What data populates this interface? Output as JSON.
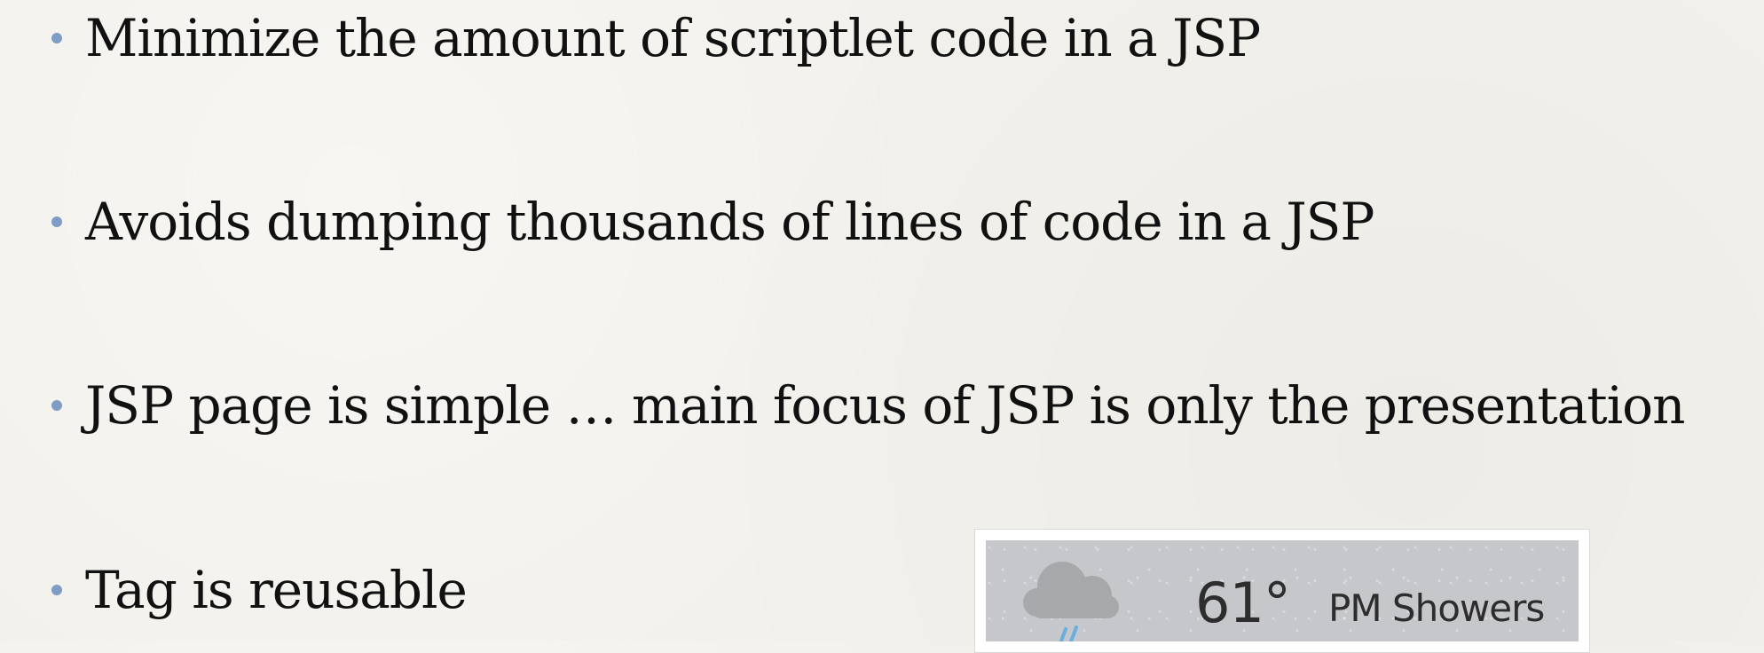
{
  "bullets": [
    "Minimize the amount of scriptlet code in a JSP",
    "Avoids dumping thousands of lines of code in a JSP",
    "JSP page is simple … main focus of JSP is only the presentation",
    "Tag is reusable"
  ],
  "weather": {
    "icon": "rain-cloud-icon",
    "temperature": "61°",
    "condition": "PM Showers"
  },
  "colors": {
    "background": "#f3f1ec",
    "bullet": "#7f9cc4",
    "text": "#111111",
    "widget_bg": "#c5c7ca",
    "widget_text": "#2d2d2d"
  }
}
